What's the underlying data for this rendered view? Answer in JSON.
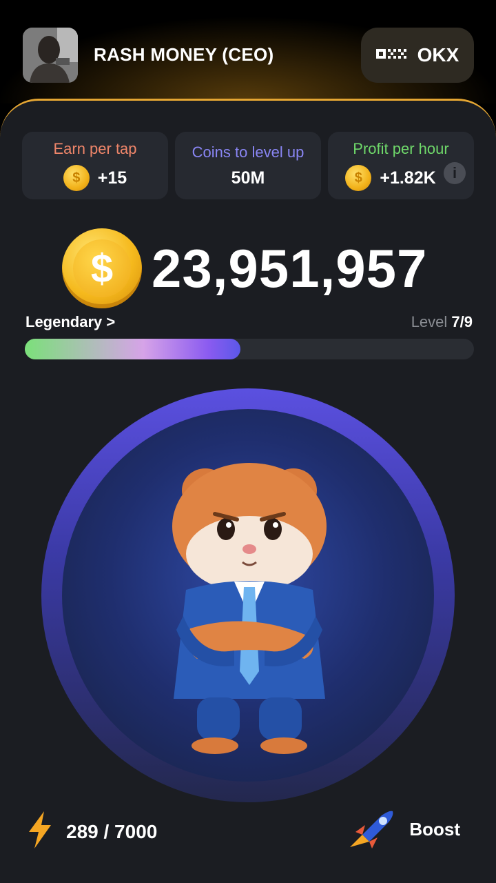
{
  "header": {
    "user_name": "RASH MONEY (CEO)",
    "exchange_label": "OKX",
    "accent": "#e6a733"
  },
  "stats": [
    {
      "title": "Earn per tap",
      "value": "+15",
      "title_color": "#f0866a",
      "icon": "coin-icon"
    },
    {
      "title": "Coins to level up",
      "value": "50M",
      "title_color": "#8a86f5"
    },
    {
      "title": "Profit per hour",
      "value": "+1.82K",
      "title_color": "#6fd86a",
      "icon": "coin-icon"
    }
  ],
  "balance": {
    "coin_symbol": "$",
    "value": "23,951,957"
  },
  "level": {
    "rank": "Legendary >",
    "label": "Level",
    "value": "7/9",
    "progress_fraction": 0.48
  },
  "energy": {
    "value": "289 / 7000"
  },
  "boost": {
    "label": "Boost"
  }
}
